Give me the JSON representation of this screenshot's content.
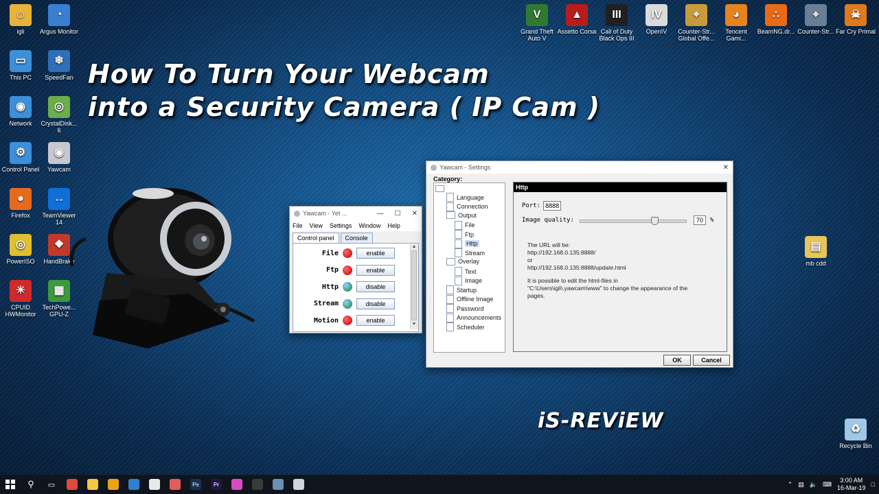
{
  "desktop_left": [
    {
      "label": "igli",
      "color": "#e8b33a",
      "glyph": "☺"
    },
    {
      "label": "Argus Monitor",
      "color": "#3a7ecf",
      "glyph": "◔"
    },
    {
      "label": "This PC",
      "color": "#3d8fd8",
      "glyph": "▭"
    },
    {
      "label": "SpeedFan",
      "color": "#2f6fb7",
      "glyph": "❄"
    },
    {
      "label": "Network",
      "color": "#3d8fd8",
      "glyph": "◉"
    },
    {
      "label": "CrystalDisk... 6",
      "color": "#6cae4a",
      "glyph": "◎"
    },
    {
      "label": "Control Panel",
      "color": "#3d8fd8",
      "glyph": "⚙"
    },
    {
      "label": "Yawcam",
      "color": "#c8c8d0",
      "glyph": "◉"
    },
    {
      "label": "Firefox",
      "color": "#e66a1e",
      "glyph": "●"
    },
    {
      "label": "TeamViewer 14",
      "color": "#0e6fd8",
      "glyph": "↔"
    },
    {
      "label": "PowerISO",
      "color": "#e0c030",
      "glyph": "◎"
    },
    {
      "label": "HandBrake",
      "color": "#c0392b",
      "glyph": "❖"
    },
    {
      "label": "CPUID HWMonitor",
      "color": "#d12a2a",
      "glyph": "☀"
    },
    {
      "label": "TechPowe... GPU-Z",
      "color": "#3c9a3c",
      "glyph": "▦"
    }
  ],
  "desktop_top": [
    {
      "label": "Grand Theft Auto V",
      "color": "#2f7a2f",
      "glyph": "V"
    },
    {
      "label": "Assetto Corsa",
      "color": "#b81d1d",
      "glyph": "▲"
    },
    {
      "label": "Call of Duty Black Ops III",
      "color": "#202020",
      "glyph": "III"
    },
    {
      "label": "OpenIV",
      "color": "#dadada",
      "glyph": "IV"
    },
    {
      "label": "Counter-Str... Global Offe...",
      "color": "#c99a3c",
      "glyph": "⌖"
    },
    {
      "label": "Tencent Gami...",
      "color": "#e7831f",
      "glyph": "◕"
    },
    {
      "label": "BeamNG.dr...",
      "color": "#e96a16",
      "glyph": "∴"
    },
    {
      "label": "Counter-Str...",
      "color": "#6a7f95",
      "glyph": "⌖"
    },
    {
      "label": "Far Cry Primal",
      "color": "#e07a1c",
      "glyph": "☠"
    }
  ],
  "desktop_right": [
    {
      "label": "mb cdd",
      "color": "#e8c55a",
      "glyph": "▤"
    },
    {
      "label": "Recycle Bin",
      "color": "#9fc7e6",
      "glyph": "♻"
    }
  ],
  "headline": {
    "line1": "How To Turn Your Webcam",
    "line2": "into a Security Camera ( IP Cam )"
  },
  "brand": "iS-REViEW",
  "yawcam": {
    "title": "Yawcam - Yet ...",
    "menu": [
      "File",
      "View",
      "Settings",
      "Window",
      "Help"
    ],
    "tabs": [
      "Control panel",
      "Console"
    ],
    "rows": [
      {
        "label": "File",
        "status": "off",
        "button": "enable"
      },
      {
        "label": "Ftp",
        "status": "off",
        "button": "enable"
      },
      {
        "label": "Http",
        "status": "on",
        "button": "disable"
      },
      {
        "label": "Stream",
        "status": "on",
        "button": "disable"
      },
      {
        "label": "Motion",
        "status": "off",
        "button": "enable"
      }
    ]
  },
  "settings": {
    "title": "Yawcam - Settings",
    "category_label": "Category:",
    "tree": [
      {
        "label": "Language",
        "level": 1,
        "type": "doc"
      },
      {
        "label": "Connection",
        "level": 1,
        "type": "doc"
      },
      {
        "label": "Output",
        "level": 1,
        "type": "folder"
      },
      {
        "label": "File",
        "level": 2,
        "type": "doc"
      },
      {
        "label": "Ftp",
        "level": 2,
        "type": "doc"
      },
      {
        "label": "Http",
        "level": 2,
        "type": "doc",
        "selected": true
      },
      {
        "label": "Stream",
        "level": 2,
        "type": "doc"
      },
      {
        "label": "Overlay",
        "level": 1,
        "type": "folder"
      },
      {
        "label": "Text",
        "level": 2,
        "type": "doc"
      },
      {
        "label": "Image",
        "level": 2,
        "type": "doc"
      },
      {
        "label": "Startup",
        "level": 1,
        "type": "doc"
      },
      {
        "label": "Offline Image",
        "level": 1,
        "type": "doc"
      },
      {
        "label": "Password",
        "level": 1,
        "type": "doc"
      },
      {
        "label": "Announcements",
        "level": 1,
        "type": "doc"
      },
      {
        "label": "Scheduler",
        "level": 1,
        "type": "doc"
      }
    ],
    "panel_title": "Http",
    "port_label": "Port:",
    "port_value": "8888",
    "quality_label": "Image quality:",
    "quality_value": "70",
    "quality_unit": "%",
    "quality_fraction": 0.7,
    "info": {
      "l1": "The URL will be:",
      "l2": "http://192.168.0.135:8888/",
      "l3": "or",
      "l4": "http://192.168.0.135:8888/update.html",
      "l5": "It is possible to edit the html-files in",
      "l6": "\"C:\\Users\\igli\\.yawcam\\www\" to change the appearance of the",
      "l7": "pages."
    },
    "ok": "OK",
    "cancel": "Cancel"
  },
  "taskbar": {
    "apps": [
      {
        "name": "chrome",
        "color": "#dd4b39"
      },
      {
        "name": "explorer",
        "color": "#f2c744"
      },
      {
        "name": "media-player",
        "color": "#e8a317"
      },
      {
        "name": "store",
        "color": "#2f7fd1"
      },
      {
        "name": "itunes",
        "color": "#e9e9e9"
      },
      {
        "name": "app-circle",
        "color": "#e35d5d"
      },
      {
        "name": "photoshop",
        "color": "#1c2f4d"
      },
      {
        "name": "premiere",
        "color": "#2b1240"
      },
      {
        "name": "color-app",
        "color": "#d94cc1"
      },
      {
        "name": "sublime",
        "color": "#3a3a3a"
      },
      {
        "name": "monitor",
        "color": "#6a8fb0"
      },
      {
        "name": "yawcam",
        "color": "#cfd3da"
      }
    ],
    "app_labels": {
      "photoshop": "Ps",
      "premiere": "Pr"
    },
    "time": "3:00 AM",
    "date": "16-Mar-19"
  }
}
